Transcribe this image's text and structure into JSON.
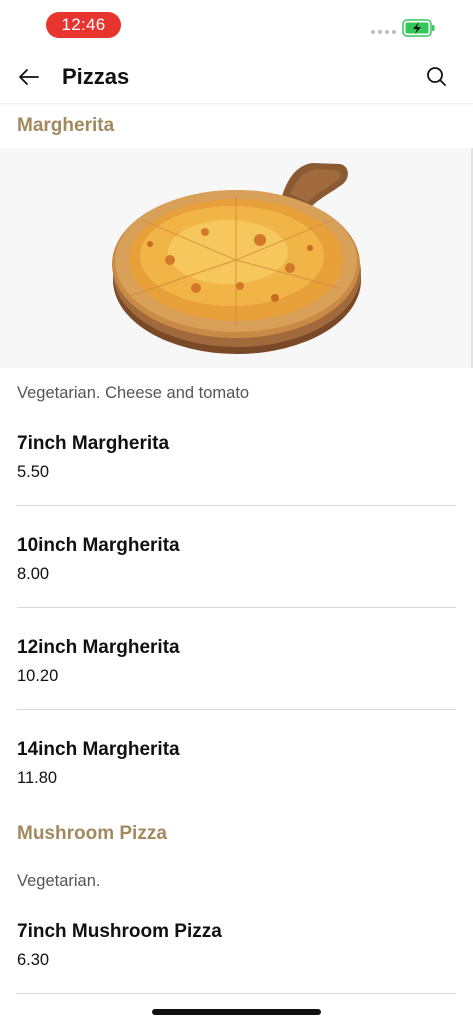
{
  "status_bar": {
    "time": "12:46"
  },
  "header": {
    "title": "Pizzas"
  },
  "sections": [
    {
      "title": "Margherita",
      "description": "Vegetarian. Cheese and tomato",
      "items": [
        {
          "name": "7inch Margherita",
          "price": "5.50"
        },
        {
          "name": "10inch Margherita",
          "price": "8.00"
        },
        {
          "name": "12inch Margherita",
          "price": "10.20"
        },
        {
          "name": "14inch Margherita",
          "price": "11.80"
        }
      ]
    },
    {
      "title": "Mushroom Pizza",
      "description": "Vegetarian.",
      "items": [
        {
          "name": "7inch Mushroom Pizza",
          "price": "6.30"
        }
      ]
    }
  ],
  "colors": {
    "accent": "#a3895e",
    "time_pill": "#e8342e",
    "battery": "#34c759"
  },
  "icons": [
    "back-arrow-icon",
    "search-icon",
    "battery-charging-icon"
  ]
}
